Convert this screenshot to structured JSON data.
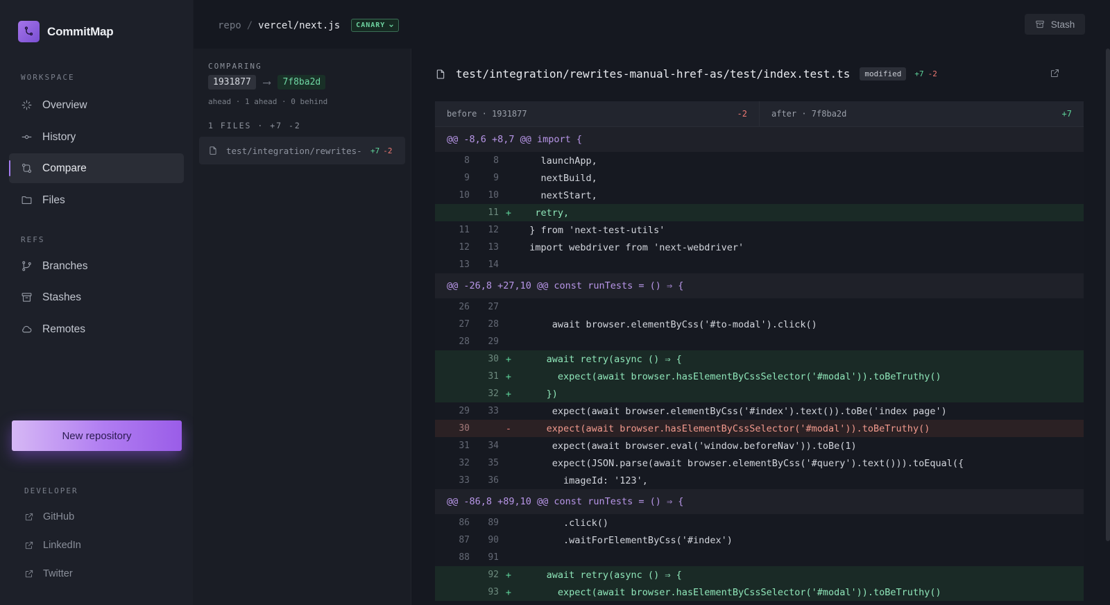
{
  "app": {
    "name": "CommitMap"
  },
  "sidebar": {
    "workspace_label": "WORKSPACE",
    "workspace_items": [
      {
        "label": "Overview",
        "icon": "sparkle-icon"
      },
      {
        "label": "History",
        "icon": "commit-icon"
      },
      {
        "label": "Compare",
        "icon": "compare-icon",
        "active": true
      },
      {
        "label": "Files",
        "icon": "folder-icon"
      }
    ],
    "refs_label": "REFS",
    "refs_items": [
      {
        "label": "Branches",
        "icon": "branch-icon"
      },
      {
        "label": "Stashes",
        "icon": "archive-icon"
      },
      {
        "label": "Remotes",
        "icon": "cloud-icon"
      }
    ],
    "new_repo_label": "New repository",
    "developer_label": "DEVELOPER",
    "developer_links": [
      {
        "label": "GitHub",
        "icon": "external-link-icon"
      },
      {
        "label": "LinkedIn",
        "icon": "external-link-icon"
      },
      {
        "label": "Twitter",
        "icon": "external-link-icon"
      }
    ]
  },
  "topbar": {
    "crumb_root": "repo",
    "crumb_sep": "/",
    "repo_name": "vercel/next.js",
    "branch": "CANARY",
    "stash_label": "Stash"
  },
  "compare": {
    "label": "COMPARING",
    "base_sha": "1931877",
    "arrow": "⟶",
    "head_sha": "7f8ba2d",
    "ahead_text": "ahead · 1 ahead · 0 behind",
    "files_label": "1 FILES · +7 -2",
    "files": [
      {
        "name": "test/integration/rewrites-…",
        "added": "+7",
        "removed": "-2"
      }
    ]
  },
  "diff": {
    "path": "test/integration/rewrites-manual-href-as/test/index.test.ts",
    "status": "modified",
    "added": "+7",
    "removed": "-2",
    "before_label": "before · 1931877",
    "before_count": "-2",
    "after_label": "after · 7f8ba2d",
    "after_count": "+7",
    "hunks": [
      {
        "header": "@@ -8,6 +8,7 @@ import {",
        "lines": [
          {
            "type": "ctx",
            "old": "8",
            "new": "8",
            "mark": "",
            "code": "    launchApp,"
          },
          {
            "type": "ctx",
            "old": "9",
            "new": "9",
            "mark": "",
            "code": "    nextBuild,"
          },
          {
            "type": "ctx",
            "old": "10",
            "new": "10",
            "mark": "",
            "code": "    nextStart,"
          },
          {
            "type": "added",
            "old": "",
            "new": "11",
            "mark": "+",
            "code": "   retry,"
          },
          {
            "type": "ctx",
            "old": "11",
            "new": "12",
            "mark": "",
            "code": "  } from 'next-test-utils'"
          },
          {
            "type": "ctx",
            "old": "12",
            "new": "13",
            "mark": "",
            "code": "  import webdriver from 'next-webdriver'"
          },
          {
            "type": "ctx",
            "old": "13",
            "new": "14",
            "mark": "",
            "code": ""
          }
        ]
      },
      {
        "header": "@@ -26,8 +27,10 @@ const runTests = () ⇒ {",
        "lines": [
          {
            "type": "ctx",
            "old": "26",
            "new": "27",
            "mark": "",
            "code": ""
          },
          {
            "type": "ctx",
            "old": "27",
            "new": "28",
            "mark": "",
            "code": "      await browser.elementByCss('#to-modal').click()"
          },
          {
            "type": "ctx",
            "old": "28",
            "new": "29",
            "mark": "",
            "code": ""
          },
          {
            "type": "added",
            "old": "",
            "new": "30",
            "mark": "+",
            "code": "     await retry(async () ⇒ {"
          },
          {
            "type": "added",
            "old": "",
            "new": "31",
            "mark": "+",
            "code": "       expect(await browser.hasElementByCssSelector('#modal')).toBeTruthy()"
          },
          {
            "type": "added",
            "old": "",
            "new": "32",
            "mark": "+",
            "code": "     })"
          },
          {
            "type": "ctx",
            "old": "29",
            "new": "33",
            "mark": "",
            "code": "      expect(await browser.elementByCss('#index').text()).toBe('index page')"
          },
          {
            "type": "removed",
            "old": "30",
            "new": "",
            "mark": "-",
            "code": "     expect(await browser.hasElementByCssSelector('#modal')).toBeTruthy()"
          },
          {
            "type": "ctx",
            "old": "31",
            "new": "34",
            "mark": "",
            "code": "      expect(await browser.eval('window.beforeNav')).toBe(1)"
          },
          {
            "type": "ctx",
            "old": "32",
            "new": "35",
            "mark": "",
            "code": "      expect(JSON.parse(await browser.elementByCss('#query').text())).toEqual({"
          },
          {
            "type": "ctx",
            "old": "33",
            "new": "36",
            "mark": "",
            "code": "        imageId: '123',"
          }
        ]
      },
      {
        "header": "@@ -86,8 +89,10 @@ const runTests = () ⇒ {",
        "lines": [
          {
            "type": "ctx",
            "old": "86",
            "new": "89",
            "mark": "",
            "code": "        .click()"
          },
          {
            "type": "ctx",
            "old": "87",
            "new": "90",
            "mark": "",
            "code": "        .waitForElementByCss('#index')"
          },
          {
            "type": "ctx",
            "old": "88",
            "new": "91",
            "mark": "",
            "code": ""
          },
          {
            "type": "added",
            "old": "",
            "new": "92",
            "mark": "+",
            "code": "     await retry(async () ⇒ {"
          },
          {
            "type": "added",
            "old": "",
            "new": "93",
            "mark": "+",
            "code": "       expect(await browser.hasElementByCssSelector('#modal')).toBeTruthy()"
          }
        ]
      }
    ]
  }
}
